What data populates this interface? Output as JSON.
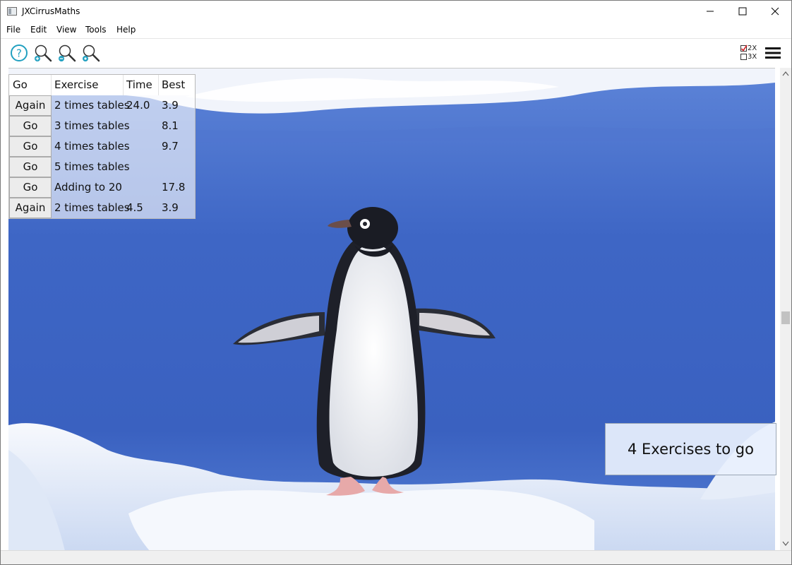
{
  "window": {
    "title": "JXCirrusMaths"
  },
  "menu": [
    "File",
    "Edit",
    "View",
    "Tools",
    "Help"
  ],
  "toolbar_icons": [
    "help-icon",
    "zoom-in-icon",
    "zoom-out-icon",
    "zoom-reset-icon"
  ],
  "toolbar_right": {
    "mode_badge": [
      "2X",
      "3X"
    ],
    "menu_icon": "hamburger-menu-icon"
  },
  "table": {
    "columns": [
      "Go",
      "Exercise",
      "Time",
      "Best"
    ],
    "rows": [
      {
        "button": "Again",
        "exercise": "2 times tables",
        "time": "24.0",
        "best": "3.9"
      },
      {
        "button": "Go",
        "exercise": "3 times tables",
        "time": "",
        "best": "8.1"
      },
      {
        "button": "Go",
        "exercise": "4 times tables",
        "time": "",
        "best": "9.7"
      },
      {
        "button": "Go",
        "exercise": "5 times tables",
        "time": "",
        "best": ""
      },
      {
        "button": "Go",
        "exercise": "Adding to 20",
        "time": "",
        "best": "17.8"
      },
      {
        "button": "Again",
        "exercise": "2 times tables",
        "time": "4.5",
        "best": "3.9"
      }
    ]
  },
  "status": {
    "text": "4 Exercises to go"
  },
  "colors": {
    "sky_blue": "#3e66c5",
    "snow": "#f4f6fb",
    "accent": "#21a0c0"
  }
}
